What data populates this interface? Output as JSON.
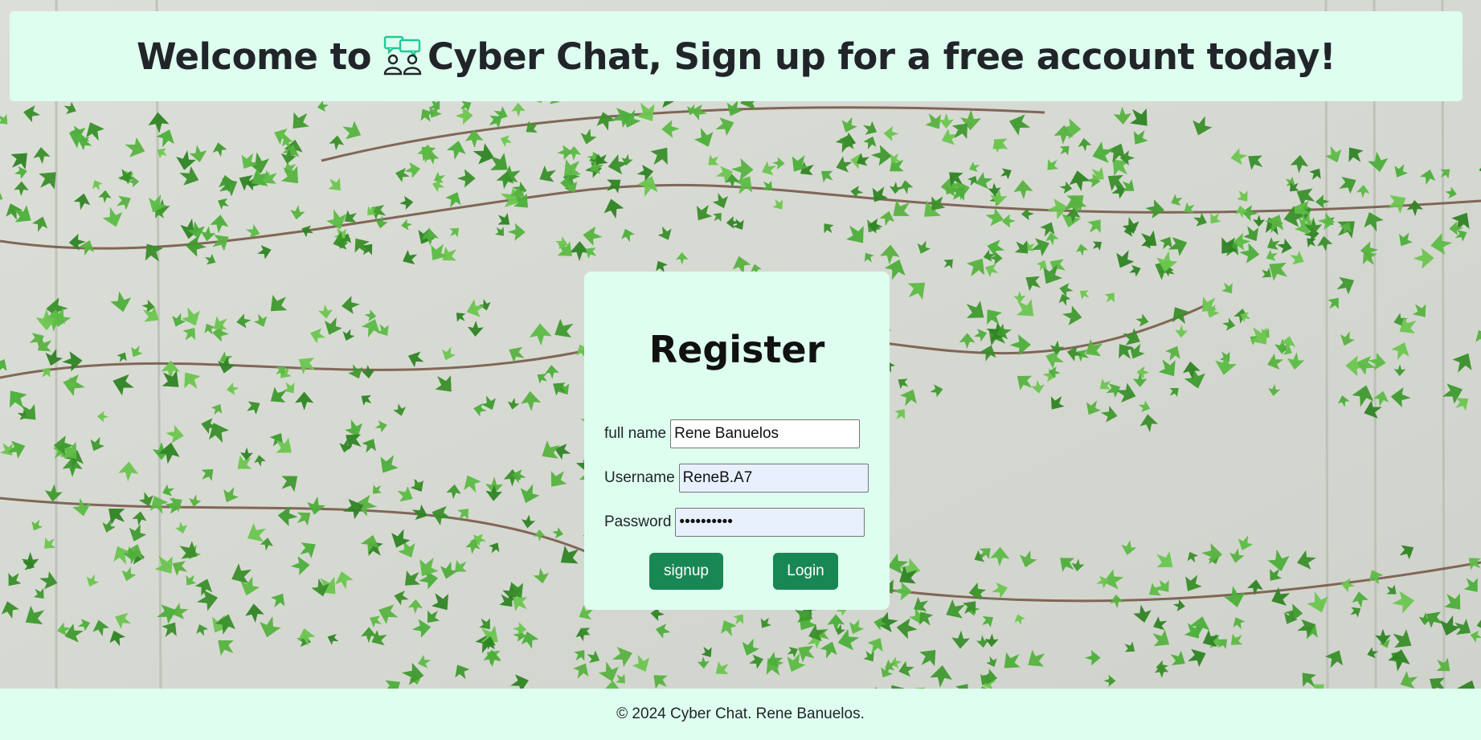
{
  "header": {
    "welcome_prefix": "Welcome to ",
    "welcome_suffix": "Cyber Chat, Sign up for a free account today!",
    "logo_icon": "chat-people-icon",
    "accent_color": "#20c997"
  },
  "register": {
    "title": "Register",
    "fullname_label": "full name",
    "fullname_value": "Rene Banuelos",
    "username_label": "Username",
    "username_value": "ReneB.A7",
    "password_label": "Password",
    "password_value": "••••••••••",
    "signup_label": "signup",
    "login_label": "Login"
  },
  "footer": {
    "text": "© 2024 Cyber Chat. Rene Banuelos."
  },
  "colors": {
    "panel_bg": "#deffef",
    "button_bg": "#198754",
    "autofill_bg": "#e8f0fe"
  }
}
